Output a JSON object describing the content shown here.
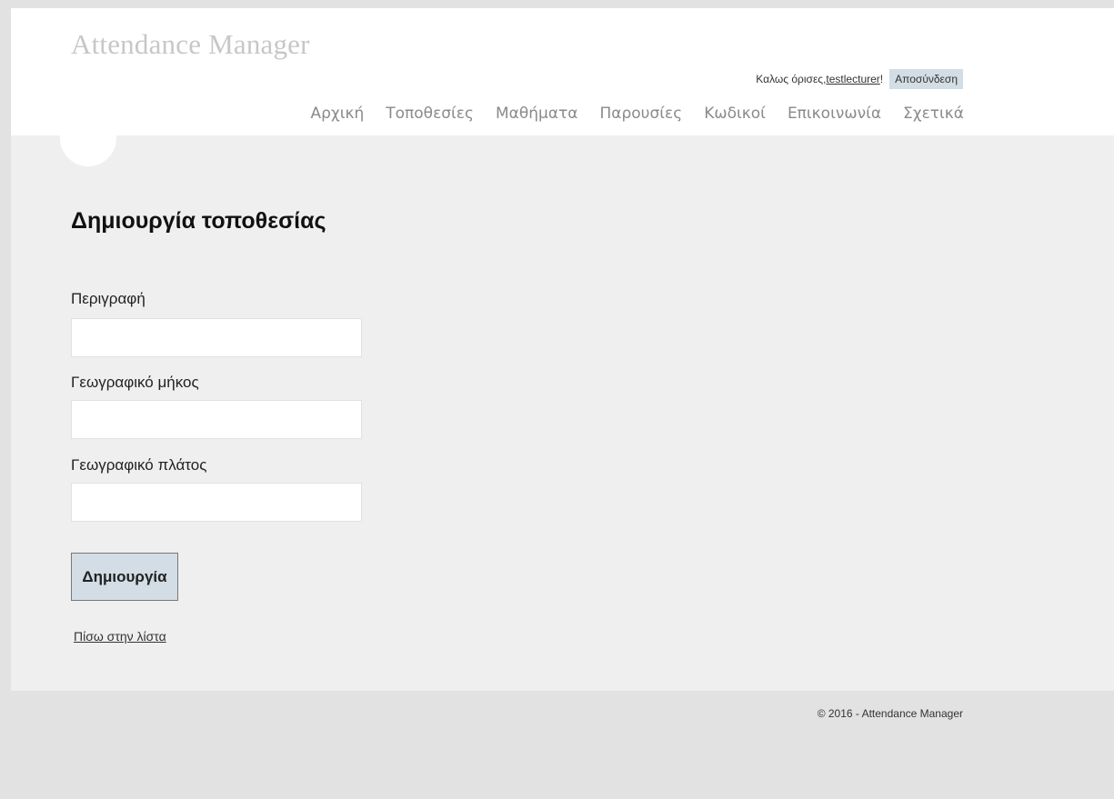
{
  "header": {
    "site_title": "Attendance Manager",
    "greeting_prefix": "Καλως όρισες, ",
    "username": "testlecturer",
    "greeting_suffix": "!",
    "logout_label": "Αποσύνδεση"
  },
  "menu": {
    "items": [
      {
        "label": "Αρχική"
      },
      {
        "label": "Τοποθεσίες"
      },
      {
        "label": "Μαθήματα"
      },
      {
        "label": "Παρουσίες"
      },
      {
        "label": "Κωδικοί"
      },
      {
        "label": "Επικοινωνία"
      },
      {
        "label": "Σχετικά"
      }
    ]
  },
  "form": {
    "title": "Δημιουργία τοποθεσίας",
    "fields": [
      {
        "label": "Περιγραφή",
        "value": "",
        "placeholder": ""
      },
      {
        "label": "Γεωγραφικό μήκος",
        "value": "",
        "placeholder": ""
      },
      {
        "label": "Γεωγραφικό πλάτος",
        "value": "",
        "placeholder": ""
      }
    ],
    "submit_label": "Δημιουργία",
    "back_link_label": "Πίσω στην λίστα"
  },
  "footer": {
    "copyright": "© 2016 - Attendance Manager"
  },
  "colors": {
    "button_bg": "#d3dde5",
    "title_gray": "#c7c7c7",
    "menu_gray": "#8a8a8a",
    "content_bg": "#efefef",
    "outer_bg": "#e2e2e2"
  }
}
